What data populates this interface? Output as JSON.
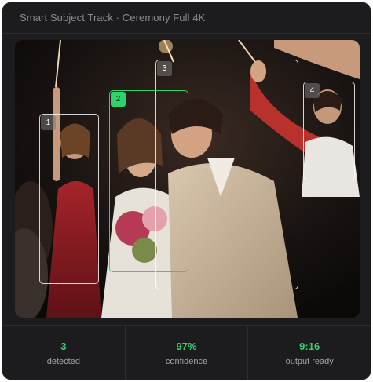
{
  "header": {
    "title": "Smart Subject Track · Ceremony Full 4K"
  },
  "boxes": [
    {
      "id": "1",
      "active": false
    },
    {
      "id": "2",
      "active": true
    },
    {
      "id": "3",
      "active": false
    },
    {
      "id": "4",
      "active": false
    }
  ],
  "stats": [
    {
      "value": "3",
      "label": "detected"
    },
    {
      "value": "97%",
      "label": "confidence"
    },
    {
      "value": "9:16",
      "label": "output ready"
    }
  ],
  "colors": {
    "accent": "#2fd36b",
    "panel": "#1c1c1e",
    "box": "#ffffff"
  }
}
